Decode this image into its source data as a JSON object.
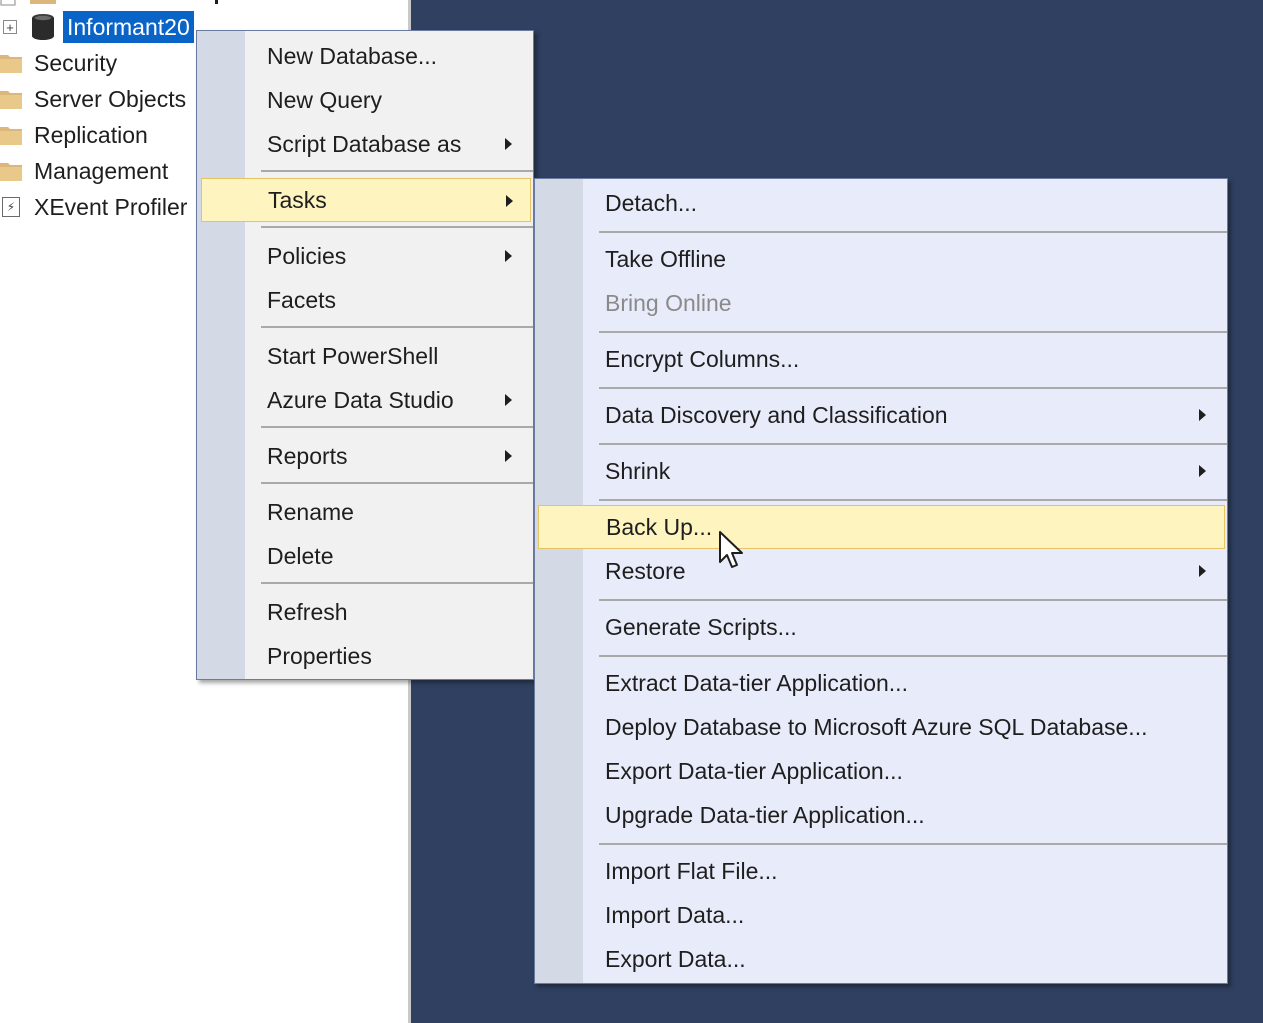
{
  "object_explorer": {
    "database_node": "Informant20",
    "items": [
      {
        "label": "Security",
        "icon": "folder-icon"
      },
      {
        "label": "Server Objects",
        "icon": "folder-icon"
      },
      {
        "label": "Replication",
        "icon": "folder-icon"
      },
      {
        "label": "Management",
        "icon": "folder-icon"
      },
      {
        "label": "XEvent Profiler",
        "icon": "xevent-icon"
      }
    ]
  },
  "context_menu": {
    "items": [
      {
        "label": "New Database..."
      },
      {
        "label": "New Query"
      },
      {
        "label": "Script Database as",
        "submenu": true
      },
      {
        "label": "Tasks",
        "submenu": true,
        "highlighted": true
      },
      {
        "label": "Policies",
        "submenu": true
      },
      {
        "label": "Facets"
      },
      {
        "label": "Start PowerShell"
      },
      {
        "label": "Azure Data Studio",
        "submenu": true
      },
      {
        "label": "Reports",
        "submenu": true
      },
      {
        "label": "Rename"
      },
      {
        "label": "Delete"
      },
      {
        "label": "Refresh"
      },
      {
        "label": "Properties"
      }
    ]
  },
  "tasks_submenu": {
    "items": [
      {
        "label": "Detach..."
      },
      {
        "label": "Take Offline"
      },
      {
        "label": "Bring Online",
        "disabled": true
      },
      {
        "label": "Encrypt Columns..."
      },
      {
        "label": "Data Discovery and Classification",
        "submenu": true
      },
      {
        "label": "Shrink",
        "submenu": true
      },
      {
        "label": "Back Up...",
        "highlighted": true
      },
      {
        "label": "Restore",
        "submenu": true
      },
      {
        "label": "Generate Scripts..."
      },
      {
        "label": "Extract Data-tier Application..."
      },
      {
        "label": "Deploy Database to Microsoft Azure SQL Database..."
      },
      {
        "label": "Export Data-tier Application..."
      },
      {
        "label": "Upgrade Data-tier Application..."
      },
      {
        "label": "Import Flat File..."
      },
      {
        "label": "Import Data..."
      },
      {
        "label": "Export Data..."
      }
    ]
  },
  "colors": {
    "workspace": "#2f4060",
    "selection": "#0a64c8",
    "highlight": "#fdf4bf",
    "folder": "#dcb67a"
  }
}
